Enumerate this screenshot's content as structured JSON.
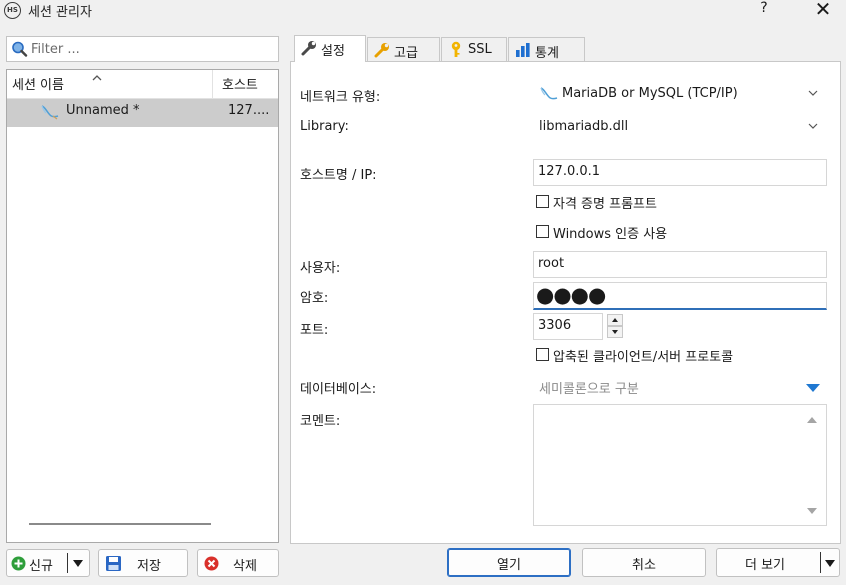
{
  "window": {
    "app_icon_text": "HS",
    "title": "세션 관리자",
    "help": "?",
    "close": "✕"
  },
  "sidebar": {
    "filter_placeholder": "Filter ...",
    "columns": {
      "name": "세션 이름",
      "host": "호스트"
    },
    "sort_indicator": "^",
    "sessions": [
      {
        "name": "Unnamed *",
        "host": "127...."
      }
    ]
  },
  "tabs": [
    {
      "label": "설정",
      "icon": "wrench-icon",
      "active": true
    },
    {
      "label": "고급",
      "icon": "wrench-orange-icon",
      "active": false
    },
    {
      "label": "SSL",
      "icon": "key-icon",
      "active": false
    },
    {
      "label": "통계",
      "icon": "bar-chart-icon",
      "active": false
    }
  ],
  "settings": {
    "network_type_label": "네트워크 유형:",
    "network_type_value": "MariaDB or MySQL (TCP/IP)",
    "library_label": "Library:",
    "library_value": "libmariadb.dll",
    "host_label": "호스트명 / IP:",
    "host_value": "127.0.0.1",
    "prompt_credentials_label": "자격 증명 프롬프트",
    "windows_auth_label": "Windows 인증 사용",
    "user_label": "사용자:",
    "user_value": "root",
    "password_label": "암호:",
    "password_mask": "●●●●",
    "port_label": "포트:",
    "port_value": "3306",
    "compressed_label": "압축된 클라이언트/서버 프로토콜",
    "databases_label": "데이터베이스:",
    "databases_placeholder": "세미콜론으로 구분",
    "comment_label": "코멘트:"
  },
  "buttons": {
    "new": "신규",
    "save": "저장",
    "delete": "삭제",
    "open": "열기",
    "cancel": "취소",
    "more": "더 보기"
  },
  "colors": {
    "accent_blue": "#2d6fc4",
    "selection_gray": "#cccccc",
    "wrench_gray": "#4a4a4a",
    "wrench_orange": "#e8a100",
    "key_yellow": "#f2b400",
    "chart_blue": "#1e6fd0",
    "new_green": "#2e9e3a",
    "delete_red": "#d9302a",
    "dropdown_blue": "#1f78d1"
  }
}
